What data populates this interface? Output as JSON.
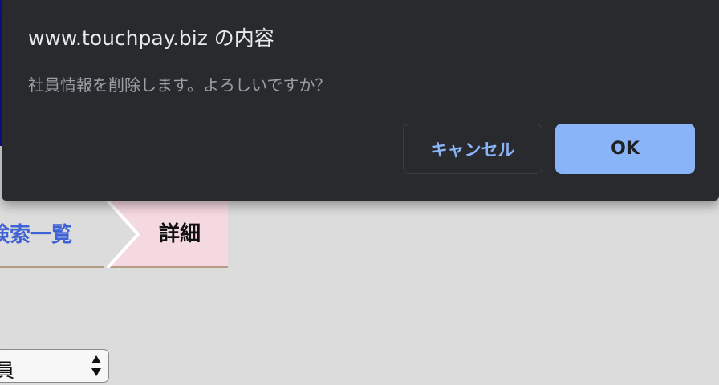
{
  "dialog": {
    "title": "www.touchpay.biz の内容",
    "message": "社員情報を削除します。よろしいですか？",
    "cancel_label": "キャンセル",
    "ok_label": "OK",
    "colors": {
      "background": "#292a2d",
      "accent": "#8ab4f8"
    }
  },
  "breadcrumb": {
    "previous_label": "検索一覧",
    "current_label": "詳細"
  },
  "form": {
    "select_value": "員"
  }
}
